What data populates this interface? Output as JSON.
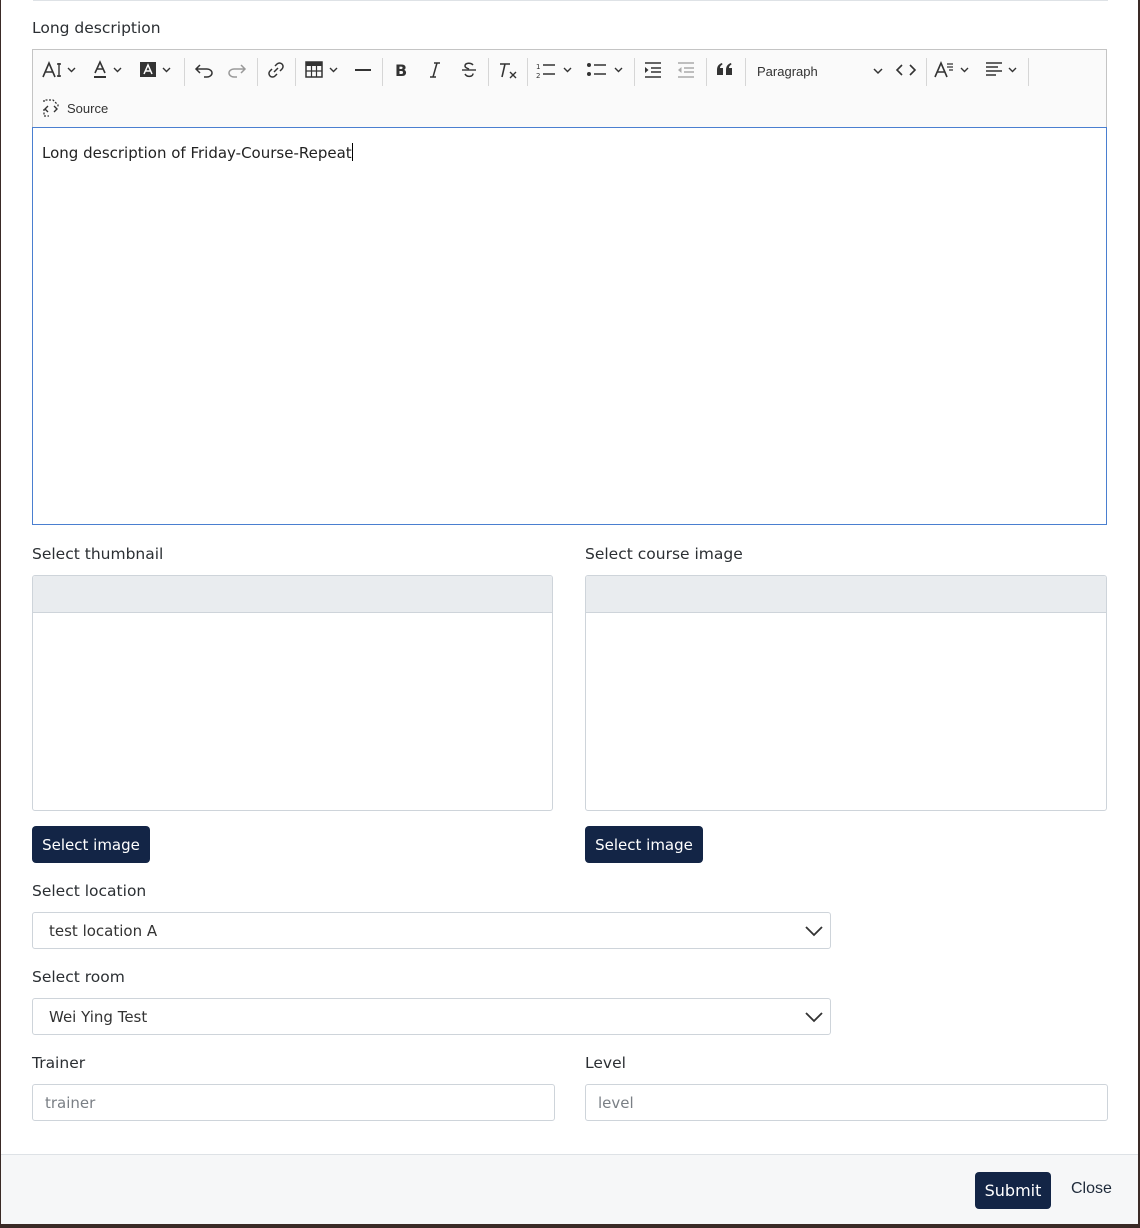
{
  "editor": {
    "label": "Long description",
    "paragraph_style": "Paragraph",
    "source_label": "Source",
    "content": "Long description of Friday-Course-Repeat"
  },
  "thumbnail": {
    "label": "Select thumbnail",
    "button": "Select image"
  },
  "course_image": {
    "label": "Select course image",
    "button": "Select image"
  },
  "location": {
    "label": "Select location",
    "value": "test location A"
  },
  "room": {
    "label": "Select room",
    "value": "Wei Ying Test"
  },
  "trainer": {
    "label": "Trainer",
    "placeholder": "trainer"
  },
  "level": {
    "label": "Level",
    "placeholder": "level"
  },
  "footer": {
    "submit": "Submit",
    "close": "Close"
  },
  "colors": {
    "primary": "#132546",
    "focus_border": "#4a7fd0"
  }
}
